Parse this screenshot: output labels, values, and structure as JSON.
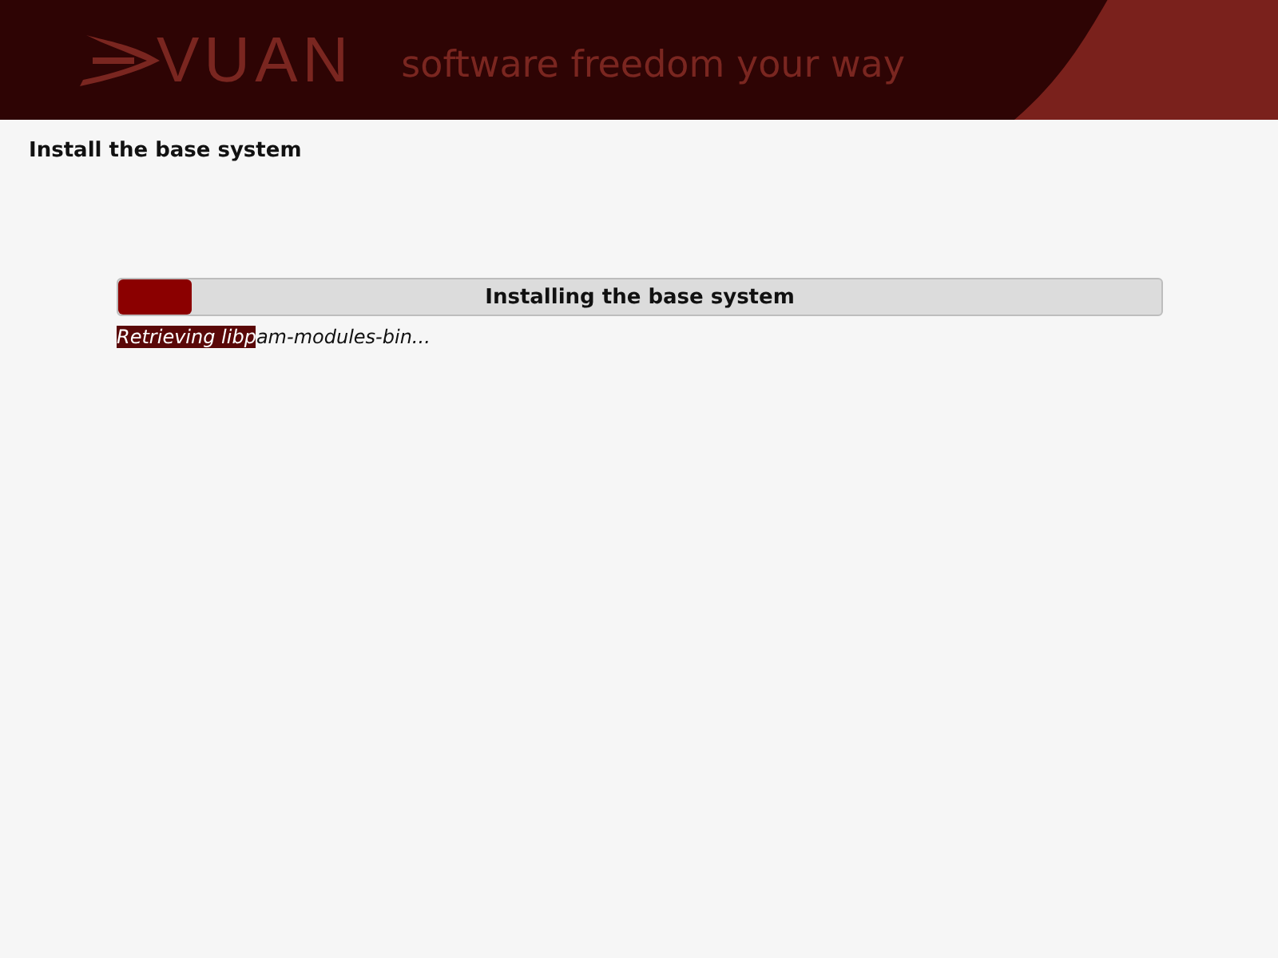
{
  "header": {
    "logo_text": "VUAN",
    "tagline": "software freedom your way"
  },
  "title": "Install the base system",
  "progress": {
    "label": "Installing the base system",
    "level": 0.07
  },
  "status_text": [
    {
      "text": "Retrieving libp",
      "selected": true
    },
    {
      "text": "am-modules-bin...",
      "selected": false
    }
  ]
}
